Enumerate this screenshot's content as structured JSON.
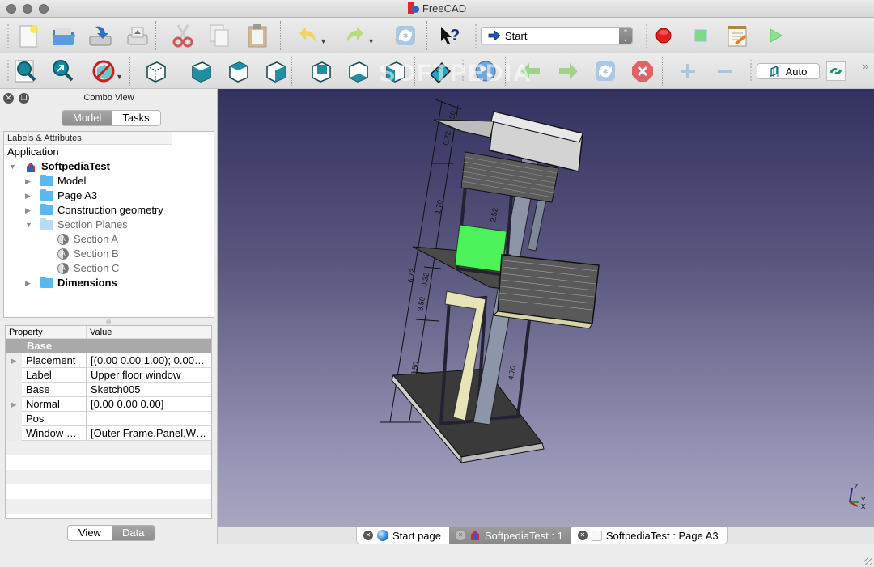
{
  "window": {
    "title": "FreeCAD"
  },
  "toolbar1": {
    "buttons": [
      {
        "name": "new-document",
        "tooltip": "New"
      },
      {
        "name": "open-document",
        "tooltip": "Open"
      },
      {
        "name": "save-document",
        "tooltip": "Save"
      },
      {
        "name": "print-document",
        "tooltip": "Print"
      },
      {
        "name": "cut",
        "tooltip": "Cut"
      },
      {
        "name": "copy",
        "tooltip": "Copy"
      },
      {
        "name": "paste",
        "tooltip": "Paste"
      },
      {
        "name": "undo",
        "tooltip": "Undo"
      },
      {
        "name": "redo",
        "tooltip": "Redo"
      },
      {
        "name": "refresh",
        "tooltip": "Refresh"
      },
      {
        "name": "whats-this",
        "tooltip": "What's This?"
      }
    ],
    "workbench": {
      "selected": "Start"
    },
    "macro_buttons": [
      {
        "name": "record-macro",
        "tooltip": "Macro recording"
      },
      {
        "name": "stop-macro",
        "tooltip": "Stop macro recording"
      },
      {
        "name": "edit-macro",
        "tooltip": "Macros"
      },
      {
        "name": "execute-macro",
        "tooltip": "Execute macro"
      }
    ]
  },
  "toolbar2": {
    "buttons": [
      {
        "name": "fit-all"
      },
      {
        "name": "fit-selection"
      },
      {
        "name": "draw-style"
      },
      {
        "name": "view-isometric"
      },
      {
        "name": "view-front"
      },
      {
        "name": "view-top"
      },
      {
        "name": "view-right"
      },
      {
        "name": "view-rear"
      },
      {
        "name": "view-bottom"
      },
      {
        "name": "view-left"
      },
      {
        "name": "measure-distance"
      },
      {
        "name": "web-browser"
      },
      {
        "name": "back"
      },
      {
        "name": "forward"
      },
      {
        "name": "reload"
      },
      {
        "name": "stop"
      },
      {
        "name": "zoom-in"
      },
      {
        "name": "zoom-out"
      }
    ],
    "auto_label": "Auto",
    "more_label": "»",
    "watermark": "SOFTPEDIA"
  },
  "combo_view": {
    "title": "Combo View",
    "tabs": [
      {
        "label": "Model",
        "active": true
      },
      {
        "label": "Tasks",
        "active": false
      }
    ],
    "tree": {
      "header": "Labels & Attributes",
      "root": "Application",
      "items": [
        {
          "label": "SoftpediaTest",
          "level": 1,
          "expanded": true,
          "bold": true,
          "icon": "document"
        },
        {
          "label": "Model",
          "level": 2,
          "expanded": false,
          "icon": "folder"
        },
        {
          "label": "Page A3",
          "level": 2,
          "expanded": false,
          "icon": "folder"
        },
        {
          "label": "Construction geometry",
          "level": 2,
          "expanded": false,
          "icon": "folder"
        },
        {
          "label": "Section Planes",
          "level": 2,
          "expanded": true,
          "icon": "folder",
          "hidden": true
        },
        {
          "label": "Section A",
          "level": 3,
          "icon": "section-plane",
          "hidden": true
        },
        {
          "label": "Section B",
          "level": 3,
          "icon": "section-plane",
          "hidden": true
        },
        {
          "label": "Section C",
          "level": 3,
          "icon": "section-plane",
          "hidden": true
        },
        {
          "label": "Dimensions",
          "level": 2,
          "expanded": false,
          "bold": true,
          "icon": "folder"
        }
      ]
    },
    "properties": {
      "headers": {
        "property": "Property",
        "value": "Value"
      },
      "group": "Base",
      "rows": [
        {
          "key": "Placement",
          "value": "[(0.00 0.00 1.00); 0.00…",
          "expandable": true
        },
        {
          "key": "Label",
          "value": "Upper floor window",
          "expandable": false
        },
        {
          "key": "Base",
          "value": "Sketch005",
          "expandable": false
        },
        {
          "key": "Normal",
          "value": "[0.00 0.00 0.00]",
          "expandable": true
        },
        {
          "key": "Pos",
          "value": "",
          "expandable": false
        },
        {
          "key": "Window …",
          "value": "[Outer Frame,Panel,W…",
          "expandable": false
        }
      ]
    },
    "bottom_tabs": [
      {
        "label": "View",
        "active": false
      },
      {
        "label": "Data",
        "active": true
      }
    ]
  },
  "viewport": {
    "dimension_labels": [
      "0.50",
      "0.72",
      "1.70",
      "2.52",
      "6.72",
      "0.32",
      "3.50",
      "2.50",
      "4.70"
    ],
    "axis_labels": {
      "z": "Z",
      "y": "Y",
      "x": "X"
    },
    "colors": {
      "bg_top": "#33315f",
      "bg_bottom": "#a7a6c1",
      "selected": "#4cf25a"
    }
  },
  "doc_tabs": [
    {
      "label": "Start page",
      "icon": "globe",
      "active": false
    },
    {
      "label": "SoftpediaTest : 1",
      "icon": "freecad",
      "active": true
    },
    {
      "label": "SoftpediaTest : Page A3",
      "icon": "blank-page",
      "active": false
    }
  ]
}
